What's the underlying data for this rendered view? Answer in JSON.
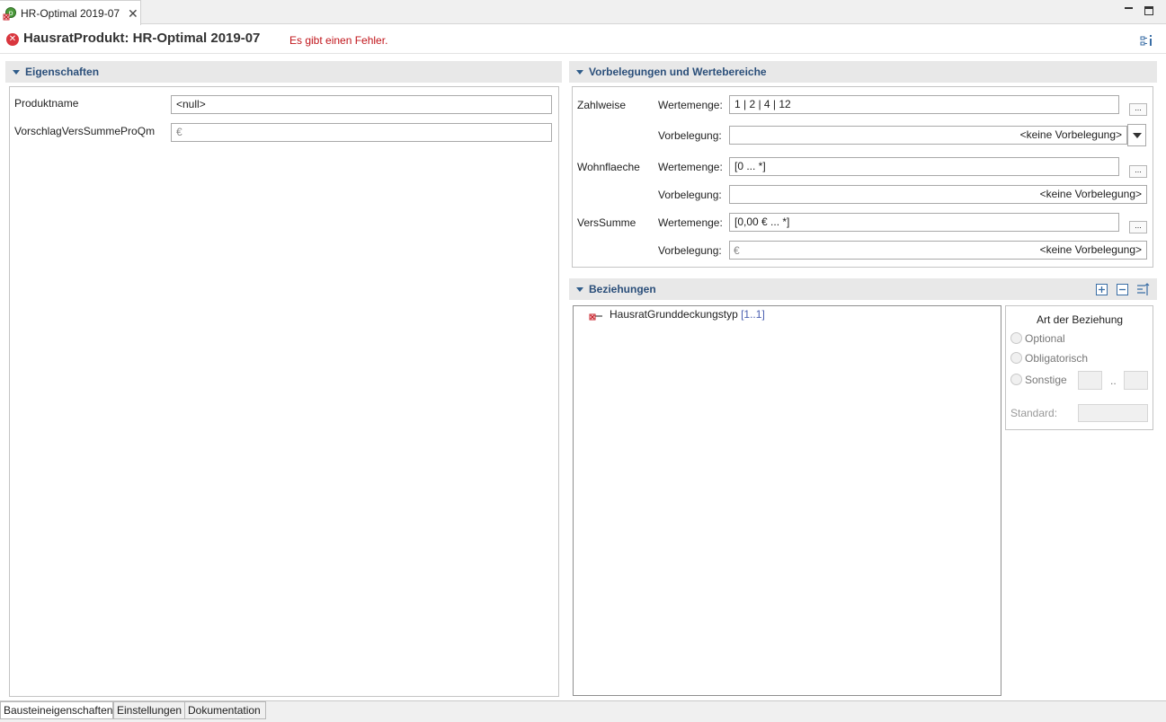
{
  "tab": {
    "title": "HR-Optimal 2019-07"
  },
  "header": {
    "title": "HausratProdukt: HR-Optimal 2019-07",
    "error": "Es gibt einen Fehler."
  },
  "eigenschaften": {
    "title": "Eigenschaften",
    "rows": [
      {
        "label": "Produktname",
        "value": "<null>"
      },
      {
        "label": "VorschlagVersSummeProQm",
        "value": "€"
      }
    ]
  },
  "vorbelegungen": {
    "title": "Vorbelegungen und Wertebereiche",
    "wertemenge_label": "Wertemenge:",
    "vorbelegung_label": "Vorbelegung:",
    "dots": "...",
    "attrs": [
      {
        "name": "Zahlweise",
        "wertemenge": "1 | 2 | 4 | 12",
        "vorbelegung": "<keine Vorbelegung>"
      },
      {
        "name": "Wohnflaeche",
        "wertemenge": "[0 ... *]",
        "vorbelegung": "<keine Vorbelegung>"
      },
      {
        "name": "VersSumme",
        "wertemenge": "[0,00 € ... *]",
        "vorbelegung_prefix": "€",
        "vorbelegung": "<keine Vorbelegung>"
      }
    ]
  },
  "beziehungen": {
    "title": "Beziehungen",
    "item_name": "HausratGrunddeckungstyp",
    "item_card": "[1..1]",
    "art": {
      "title": "Art der Beziehung",
      "optional": "Optional",
      "obligatorisch": "Obligatorisch",
      "sonstige": "Sonstige",
      "range_sep": "..",
      "standard": "Standard:"
    }
  },
  "bottom_tabs": [
    "Bausteineigenschaften",
    "Einstellungen",
    "Dokumentation"
  ],
  "colors": {
    "section_title": "#2b4f7a",
    "error": "#c0141a",
    "section_bg": "#e8e8e8"
  }
}
